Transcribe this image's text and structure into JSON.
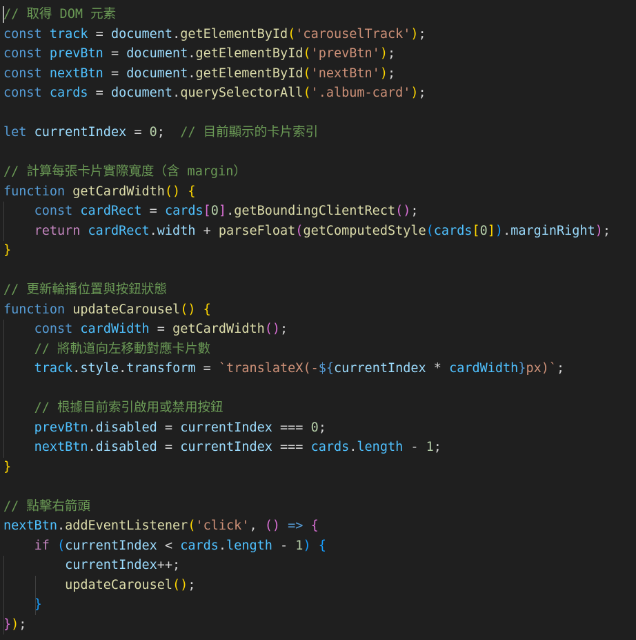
{
  "editor": {
    "language": "javascript",
    "theme_colors": {
      "background": "#1f1f1f",
      "comment": "#6a9955",
      "keyword_storage": "#569cd6",
      "keyword_control": "#c586c0",
      "variable": "#9cdcfe",
      "constant_variable": "#4fc1ff",
      "function": "#dcdcaa",
      "string": "#ce9178",
      "number": "#b5cea8",
      "punctuation": "#d4d4d4",
      "bracket_gold": "#ffd700",
      "bracket_purple": "#da70d6",
      "bracket_blue": "#179fff",
      "indent_guide": "#404040"
    },
    "lines": [
      [
        {
          "t": "// 取得 DOM 元素",
          "c": "#6a9955"
        }
      ],
      [
        {
          "t": "const",
          "c": "#569cd6"
        },
        {
          "t": " ",
          "c": "#d4d4d4"
        },
        {
          "t": "track",
          "c": "#4fc1ff"
        },
        {
          "t": " = ",
          "c": "#d4d4d4"
        },
        {
          "t": "document",
          "c": "#9cdcfe"
        },
        {
          "t": ".",
          "c": "#d4d4d4"
        },
        {
          "t": "getElementById",
          "c": "#dcdcaa"
        },
        {
          "t": "(",
          "c": "#ffd700"
        },
        {
          "t": "'carouselTrack'",
          "c": "#ce9178"
        },
        {
          "t": ")",
          "c": "#ffd700"
        },
        {
          "t": ";",
          "c": "#d4d4d4"
        }
      ],
      [
        {
          "t": "const",
          "c": "#569cd6"
        },
        {
          "t": " ",
          "c": "#d4d4d4"
        },
        {
          "t": "prevBtn",
          "c": "#4fc1ff"
        },
        {
          "t": " = ",
          "c": "#d4d4d4"
        },
        {
          "t": "document",
          "c": "#9cdcfe"
        },
        {
          "t": ".",
          "c": "#d4d4d4"
        },
        {
          "t": "getElementById",
          "c": "#dcdcaa"
        },
        {
          "t": "(",
          "c": "#ffd700"
        },
        {
          "t": "'prevBtn'",
          "c": "#ce9178"
        },
        {
          "t": ")",
          "c": "#ffd700"
        },
        {
          "t": ";",
          "c": "#d4d4d4"
        }
      ],
      [
        {
          "t": "const",
          "c": "#569cd6"
        },
        {
          "t": " ",
          "c": "#d4d4d4"
        },
        {
          "t": "nextBtn",
          "c": "#4fc1ff"
        },
        {
          "t": " = ",
          "c": "#d4d4d4"
        },
        {
          "t": "document",
          "c": "#9cdcfe"
        },
        {
          "t": ".",
          "c": "#d4d4d4"
        },
        {
          "t": "getElementById",
          "c": "#dcdcaa"
        },
        {
          "t": "(",
          "c": "#ffd700"
        },
        {
          "t": "'nextBtn'",
          "c": "#ce9178"
        },
        {
          "t": ")",
          "c": "#ffd700"
        },
        {
          "t": ";",
          "c": "#d4d4d4"
        }
      ],
      [
        {
          "t": "const",
          "c": "#569cd6"
        },
        {
          "t": " ",
          "c": "#d4d4d4"
        },
        {
          "t": "cards",
          "c": "#4fc1ff"
        },
        {
          "t": " = ",
          "c": "#d4d4d4"
        },
        {
          "t": "document",
          "c": "#9cdcfe"
        },
        {
          "t": ".",
          "c": "#d4d4d4"
        },
        {
          "t": "querySelectorAll",
          "c": "#dcdcaa"
        },
        {
          "t": "(",
          "c": "#ffd700"
        },
        {
          "t": "'.album-card'",
          "c": "#ce9178"
        },
        {
          "t": ")",
          "c": "#ffd700"
        },
        {
          "t": ";",
          "c": "#d4d4d4"
        }
      ],
      [],
      [
        {
          "t": "let",
          "c": "#569cd6"
        },
        {
          "t": " ",
          "c": "#d4d4d4"
        },
        {
          "t": "currentIndex",
          "c": "#9cdcfe"
        },
        {
          "t": " = ",
          "c": "#d4d4d4"
        },
        {
          "t": "0",
          "c": "#b5cea8"
        },
        {
          "t": ";  ",
          "c": "#d4d4d4"
        },
        {
          "t": "// 目前顯示的卡片索引",
          "c": "#6a9955"
        }
      ],
      [],
      [
        {
          "t": "// 計算每張卡片實際寬度（含 margin）",
          "c": "#6a9955"
        }
      ],
      [
        {
          "t": "function",
          "c": "#569cd6"
        },
        {
          "t": " ",
          "c": "#d4d4d4"
        },
        {
          "t": "getCardWidth",
          "c": "#dcdcaa"
        },
        {
          "t": "()",
          "c": "#ffd700"
        },
        {
          "t": " ",
          "c": "#d4d4d4"
        },
        {
          "t": "{",
          "c": "#ffd700"
        }
      ],
      [
        {
          "t": "    ",
          "c": "#d4d4d4"
        },
        {
          "t": "const",
          "c": "#569cd6"
        },
        {
          "t": " ",
          "c": "#d4d4d4"
        },
        {
          "t": "cardRect",
          "c": "#4fc1ff"
        },
        {
          "t": " = ",
          "c": "#d4d4d4"
        },
        {
          "t": "cards",
          "c": "#4fc1ff"
        },
        {
          "t": "[",
          "c": "#da70d6"
        },
        {
          "t": "0",
          "c": "#b5cea8"
        },
        {
          "t": "]",
          "c": "#da70d6"
        },
        {
          "t": ".",
          "c": "#d4d4d4"
        },
        {
          "t": "getBoundingClientRect",
          "c": "#dcdcaa"
        },
        {
          "t": "()",
          "c": "#da70d6"
        },
        {
          "t": ";",
          "c": "#d4d4d4"
        }
      ],
      [
        {
          "t": "    ",
          "c": "#d4d4d4"
        },
        {
          "t": "return",
          "c": "#c586c0"
        },
        {
          "t": " ",
          "c": "#d4d4d4"
        },
        {
          "t": "cardRect",
          "c": "#4fc1ff"
        },
        {
          "t": ".",
          "c": "#d4d4d4"
        },
        {
          "t": "width",
          "c": "#9cdcfe"
        },
        {
          "t": " + ",
          "c": "#d4d4d4"
        },
        {
          "t": "parseFloat",
          "c": "#dcdcaa"
        },
        {
          "t": "(",
          "c": "#da70d6"
        },
        {
          "t": "getComputedStyle",
          "c": "#dcdcaa"
        },
        {
          "t": "(",
          "c": "#179fff"
        },
        {
          "t": "cards",
          "c": "#4fc1ff"
        },
        {
          "t": "[",
          "c": "#ffd700"
        },
        {
          "t": "0",
          "c": "#b5cea8"
        },
        {
          "t": "]",
          "c": "#ffd700"
        },
        {
          "t": ")",
          "c": "#179fff"
        },
        {
          "t": ".",
          "c": "#d4d4d4"
        },
        {
          "t": "marginRight",
          "c": "#9cdcfe"
        },
        {
          "t": ")",
          "c": "#da70d6"
        },
        {
          "t": ";",
          "c": "#d4d4d4"
        }
      ],
      [
        {
          "t": "}",
          "c": "#ffd700"
        }
      ],
      [],
      [
        {
          "t": "// 更新輪播位置與按鈕狀態",
          "c": "#6a9955"
        }
      ],
      [
        {
          "t": "function",
          "c": "#569cd6"
        },
        {
          "t": " ",
          "c": "#d4d4d4"
        },
        {
          "t": "updateCarousel",
          "c": "#dcdcaa"
        },
        {
          "t": "()",
          "c": "#ffd700"
        },
        {
          "t": " ",
          "c": "#d4d4d4"
        },
        {
          "t": "{",
          "c": "#ffd700"
        }
      ],
      [
        {
          "t": "    ",
          "c": "#d4d4d4"
        },
        {
          "t": "const",
          "c": "#569cd6"
        },
        {
          "t": " ",
          "c": "#d4d4d4"
        },
        {
          "t": "cardWidth",
          "c": "#4fc1ff"
        },
        {
          "t": " = ",
          "c": "#d4d4d4"
        },
        {
          "t": "getCardWidth",
          "c": "#dcdcaa"
        },
        {
          "t": "()",
          "c": "#da70d6"
        },
        {
          "t": ";",
          "c": "#d4d4d4"
        }
      ],
      [
        {
          "t": "    ",
          "c": "#d4d4d4"
        },
        {
          "t": "// 將軌道向左移動對應卡片數",
          "c": "#6a9955"
        }
      ],
      [
        {
          "t": "    ",
          "c": "#d4d4d4"
        },
        {
          "t": "track",
          "c": "#4fc1ff"
        },
        {
          "t": ".",
          "c": "#d4d4d4"
        },
        {
          "t": "style",
          "c": "#9cdcfe"
        },
        {
          "t": ".",
          "c": "#d4d4d4"
        },
        {
          "t": "transform",
          "c": "#9cdcfe"
        },
        {
          "t": " = ",
          "c": "#d4d4d4"
        },
        {
          "t": "`translateX(-",
          "c": "#ce9178"
        },
        {
          "t": "${",
          "c": "#569cd6"
        },
        {
          "t": "currentIndex",
          "c": "#9cdcfe"
        },
        {
          "t": " * ",
          "c": "#d4d4d4"
        },
        {
          "t": "cardWidth",
          "c": "#4fc1ff"
        },
        {
          "t": "}",
          "c": "#569cd6"
        },
        {
          "t": "px)`",
          "c": "#ce9178"
        },
        {
          "t": ";",
          "c": "#d4d4d4"
        }
      ],
      [],
      [
        {
          "t": "    ",
          "c": "#d4d4d4"
        },
        {
          "t": "// 根據目前索引啟用或禁用按鈕",
          "c": "#6a9955"
        }
      ],
      [
        {
          "t": "    ",
          "c": "#d4d4d4"
        },
        {
          "t": "prevBtn",
          "c": "#4fc1ff"
        },
        {
          "t": ".",
          "c": "#d4d4d4"
        },
        {
          "t": "disabled",
          "c": "#9cdcfe"
        },
        {
          "t": " = ",
          "c": "#d4d4d4"
        },
        {
          "t": "currentIndex",
          "c": "#9cdcfe"
        },
        {
          "t": " === ",
          "c": "#d4d4d4"
        },
        {
          "t": "0",
          "c": "#b5cea8"
        },
        {
          "t": ";",
          "c": "#d4d4d4"
        }
      ],
      [
        {
          "t": "    ",
          "c": "#d4d4d4"
        },
        {
          "t": "nextBtn",
          "c": "#4fc1ff"
        },
        {
          "t": ".",
          "c": "#d4d4d4"
        },
        {
          "t": "disabled",
          "c": "#9cdcfe"
        },
        {
          "t": " = ",
          "c": "#d4d4d4"
        },
        {
          "t": "currentIndex",
          "c": "#9cdcfe"
        },
        {
          "t": " === ",
          "c": "#d4d4d4"
        },
        {
          "t": "cards",
          "c": "#4fc1ff"
        },
        {
          "t": ".",
          "c": "#d4d4d4"
        },
        {
          "t": "length",
          "c": "#4fc1ff"
        },
        {
          "t": " - ",
          "c": "#d4d4d4"
        },
        {
          "t": "1",
          "c": "#b5cea8"
        },
        {
          "t": ";",
          "c": "#d4d4d4"
        }
      ],
      [
        {
          "t": "}",
          "c": "#ffd700"
        }
      ],
      [],
      [
        {
          "t": "// 點擊右箭頭",
          "c": "#6a9955"
        }
      ],
      [
        {
          "t": "nextBtn",
          "c": "#4fc1ff"
        },
        {
          "t": ".",
          "c": "#d4d4d4"
        },
        {
          "t": "addEventListener",
          "c": "#dcdcaa"
        },
        {
          "t": "(",
          "c": "#ffd700"
        },
        {
          "t": "'click'",
          "c": "#ce9178"
        },
        {
          "t": ", ",
          "c": "#d4d4d4"
        },
        {
          "t": "()",
          "c": "#da70d6"
        },
        {
          "t": " ",
          "c": "#d4d4d4"
        },
        {
          "t": "=>",
          "c": "#569cd6"
        },
        {
          "t": " ",
          "c": "#d4d4d4"
        },
        {
          "t": "{",
          "c": "#da70d6"
        }
      ],
      [
        {
          "t": "    ",
          "c": "#d4d4d4"
        },
        {
          "t": "if",
          "c": "#c586c0"
        },
        {
          "t": " ",
          "c": "#d4d4d4"
        },
        {
          "t": "(",
          "c": "#179fff"
        },
        {
          "t": "currentIndex",
          "c": "#9cdcfe"
        },
        {
          "t": " < ",
          "c": "#d4d4d4"
        },
        {
          "t": "cards",
          "c": "#4fc1ff"
        },
        {
          "t": ".",
          "c": "#d4d4d4"
        },
        {
          "t": "length",
          "c": "#4fc1ff"
        },
        {
          "t": " - ",
          "c": "#d4d4d4"
        },
        {
          "t": "1",
          "c": "#b5cea8"
        },
        {
          "t": ")",
          "c": "#179fff"
        },
        {
          "t": " ",
          "c": "#d4d4d4"
        },
        {
          "t": "{",
          "c": "#179fff"
        }
      ],
      [
        {
          "t": "        ",
          "c": "#d4d4d4"
        },
        {
          "t": "currentIndex",
          "c": "#9cdcfe"
        },
        {
          "t": "++;",
          "c": "#d4d4d4"
        }
      ],
      [
        {
          "t": "        ",
          "c": "#d4d4d4"
        },
        {
          "t": "updateCarousel",
          "c": "#dcdcaa"
        },
        {
          "t": "()",
          "c": "#ffd700"
        },
        {
          "t": ";",
          "c": "#d4d4d4"
        }
      ],
      [
        {
          "t": "    ",
          "c": "#d4d4d4"
        },
        {
          "t": "}",
          "c": "#179fff"
        }
      ],
      [
        {
          "t": "}",
          "c": "#da70d6"
        },
        {
          "t": ")",
          "c": "#ffd700"
        },
        {
          "t": ";",
          "c": "#d4d4d4"
        }
      ]
    ]
  }
}
